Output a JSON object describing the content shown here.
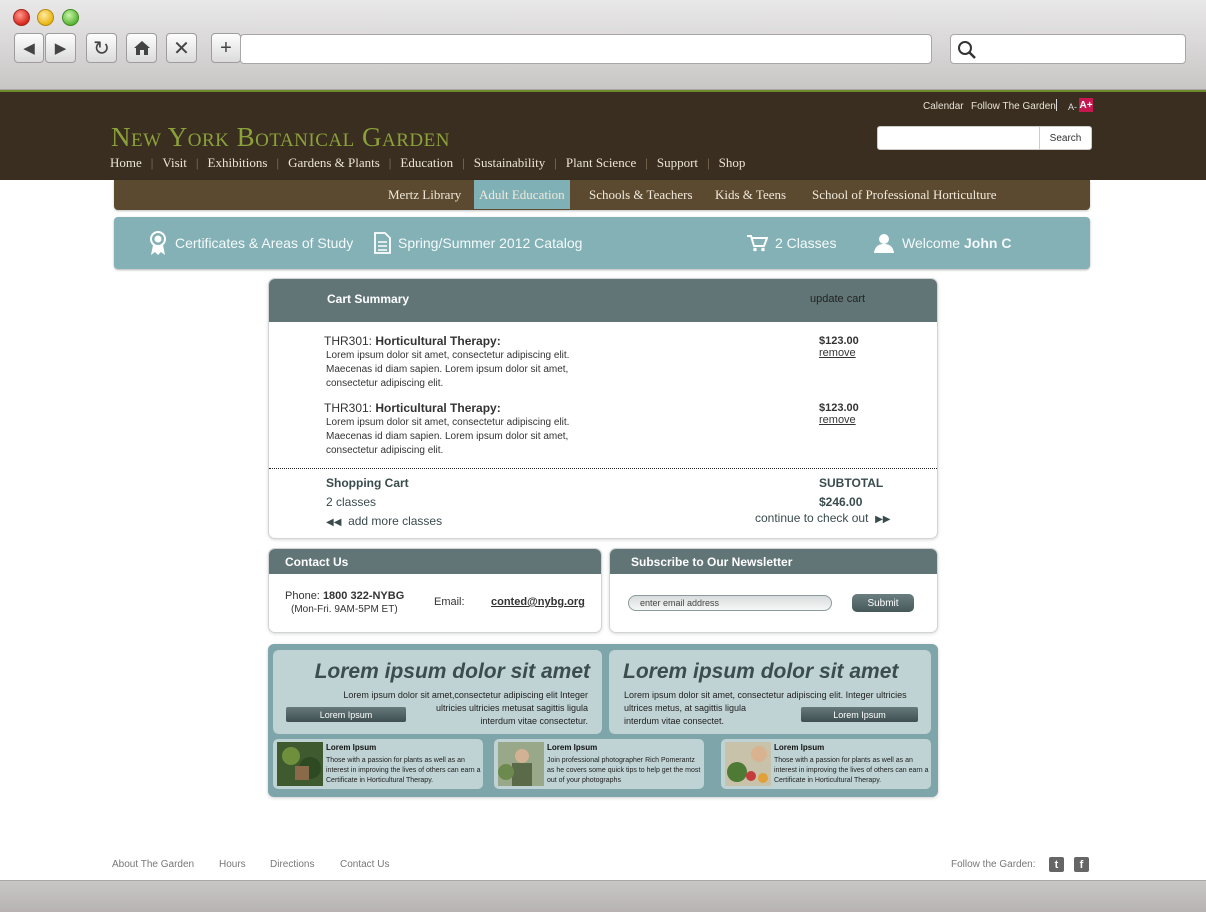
{
  "header": {
    "utility_links": [
      "Calendar",
      "Follow The Garden"
    ],
    "font_smaller": "A-",
    "font_larger": "A+",
    "logo": "New York Botanical Garden",
    "search_button": "Search",
    "nav": [
      "Home",
      "Visit",
      "Exhibitions",
      "Gardens & Plants",
      "Education",
      "Sustainability",
      "Plant Science",
      "Support",
      "Shop"
    ]
  },
  "subnav": [
    "Mertz Library",
    "Adult Education",
    "Schools & Teachers",
    "Kids & Teens",
    "School of Professional Horticulture"
  ],
  "toolbar": {
    "certificates": "Certificates & Areas of Study",
    "catalog": "Spring/Summer 2012 Catalog",
    "cart_count": "2 Classes",
    "welcome": "Welcome",
    "user": "John C"
  },
  "cart": {
    "title": "Cart Summary",
    "update_link": "update cart",
    "items": [
      {
        "code": "THR301:",
        "name": "Horticultural Therapy:",
        "desc_lines": [
          "Lorem ipsum dolor sit amet, consectetur adipiscing elit.",
          "Maecenas id diam sapien. Lorem ipsum dolor sit amet,",
          "consectetur adipiscing elit."
        ],
        "price": "$123.00",
        "remove": "remove"
      },
      {
        "code": "THR301:",
        "name": "Horticultural Therapy:",
        "desc_lines": [
          "Lorem ipsum dolor sit amet, consectetur adipiscing elit.",
          "Maecenas id diam sapien. Lorem ipsum dolor sit amet,",
          "consectetur adipiscing elit."
        ],
        "price": "$123.00",
        "remove": "remove"
      }
    ],
    "summary_title": "Shopping Cart",
    "summary_count": "2 classes",
    "add_more": "add more classes",
    "subtotal_label": "SUBTOTAL",
    "subtotal_value": "$246.00",
    "continue": "continue to check out"
  },
  "contact": {
    "title": "Contact Us",
    "phone_label": "Phone:",
    "phone": "1800 322-NYBG",
    "hours": "(Mon-Fri. 9AM-5PM ET)",
    "email_label": "Email:",
    "email": "conted@nybg.org"
  },
  "newsletter": {
    "title": "Subscribe to Our Newsletter",
    "placeholder": "enter email address",
    "submit": "Submit"
  },
  "features": [
    {
      "title": "Lorem ipsum dolor sit amet",
      "lines": [
        "Lorem ipsum dolor sit amet,consectetur adipiscing elit Integer",
        "ultricies ultricies metusat sagittis ligula",
        "interdum vitae consectetur."
      ],
      "button": "Lorem Ipsum"
    },
    {
      "title": "Lorem ipsum dolor sit amet",
      "lines": [
        "Lorem ipsum dolor sit amet, consectetur adipiscing elit. Integer ultricies",
        "ultrices metus, at sagittis ligula",
        "interdum vitae consectet."
      ],
      "button": "Lorem Ipsum"
    }
  ],
  "tiles": [
    {
      "title": "Lorem Ipsum",
      "text": "Those with a passion for plants as well as an interest in improving the lives of others can earn a Certificate in Horticultural Therapy."
    },
    {
      "title": "Lorem Ipsum",
      "text": "Join professional photographer Rich Pomerantz as he covers some quick tips to help get the most out of your photographs"
    },
    {
      "title": "Lorem Ipsum",
      "text": "Those with a passion for plants as well as an interest in improving the lives of others can earn a Certificate in Horticultural Therapy."
    }
  ],
  "footer": {
    "links": [
      "About The Garden",
      "Hours",
      "Directions",
      "Contact Us"
    ],
    "follow": "Follow the Garden:"
  },
  "colors": {
    "header_bg": "#3a2e20",
    "logo_green": "#8ba13a",
    "teal": "#83b1b6",
    "panel_head": "#617577",
    "accent_pink": "#c4184e"
  }
}
